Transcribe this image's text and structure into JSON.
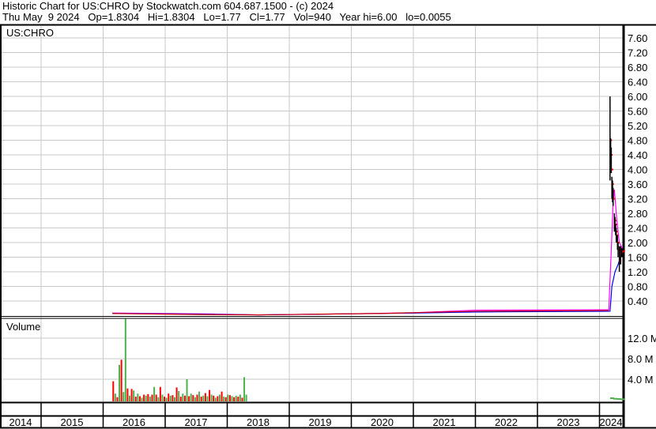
{
  "header": {
    "title": "Historic Chart for US:CHRO by Stockwatch.com 604.687.1500 - (c) 2024",
    "quote": "Thu May  9 2024   Op=1.8304   Hi=1.8304   Lo=1.77   Cl=1.77   Vol=940   Year hi=6.00   lo=0.0055"
  },
  "chart_data": [
    {
      "type": "line",
      "title": "US:CHRO",
      "ylim": [
        0,
        8
      ],
      "y_ticks": [
        "0.40",
        "0.80",
        "1.20",
        "1.60",
        "2.00",
        "2.40",
        "2.80",
        "3.20",
        "3.60",
        "4.00",
        "4.40",
        "4.80",
        "5.20",
        "5.60",
        "6.00",
        "6.40",
        "6.80",
        "7.20",
        "7.60"
      ],
      "x_ticks": [
        "2014",
        "2015",
        "2016",
        "2017",
        "2018",
        "2019",
        "2020",
        "2021",
        "2022",
        "2023",
        "2024"
      ],
      "colors": {
        "price": "#000000",
        "up": "#ff0000",
        "ma_short": "#ff00ff",
        "ma_long": "#0000ff"
      },
      "ohlc_2024": [
        [
          2024.17,
          6.0,
          3.7,
          4.8
        ],
        [
          2024.18,
          4.85,
          4.2,
          4.4
        ],
        [
          2024.19,
          4.6,
          3.9,
          4.0
        ],
        [
          2024.2,
          3.8,
          3.2,
          3.6
        ],
        [
          2024.21,
          3.7,
          3.1,
          3.4
        ],
        [
          2024.22,
          3.5,
          3.0,
          3.2
        ],
        [
          2024.24,
          2.8,
          2.3,
          2.6
        ],
        [
          2024.25,
          2.7,
          2.3,
          2.5
        ],
        [
          2024.26,
          2.5,
          2.2,
          2.3
        ],
        [
          2024.27,
          2.4,
          2.0,
          2.2
        ],
        [
          2024.29,
          2.2,
          1.8,
          2.0
        ],
        [
          2024.3,
          2.0,
          1.6,
          1.8
        ],
        [
          2024.32,
          1.9,
          1.2,
          1.5
        ],
        [
          2024.34,
          1.9,
          1.4,
          1.7
        ],
        [
          2024.36,
          1.85,
          1.6,
          1.75
        ],
        [
          2024.38,
          1.83,
          1.77,
          1.77
        ]
      ],
      "close_early": [
        [
          2016.15,
          0.06
        ],
        [
          2016.5,
          0.05
        ],
        [
          2017.0,
          0.04
        ],
        [
          2017.6,
          0.03
        ],
        [
          2018.5,
          0.02
        ],
        [
          2019.5,
          0.04
        ],
        [
          2020.5,
          0.06
        ],
        [
          2021.0,
          0.08
        ],
        [
          2022.0,
          0.12
        ],
        [
          2023.0,
          0.13
        ],
        [
          2024.15,
          0.14
        ]
      ],
      "ma_short": [
        [
          2016.15,
          0.07
        ],
        [
          2017.6,
          0.05
        ],
        [
          2018.5,
          0.02
        ],
        [
          2020.0,
          0.05
        ],
        [
          2021.0,
          0.08
        ],
        [
          2022.0,
          0.15
        ],
        [
          2024.15,
          0.16
        ],
        [
          2024.19,
          1.8
        ],
        [
          2024.22,
          3.1
        ],
        [
          2024.24,
          3.45
        ],
        [
          2024.28,
          2.6
        ],
        [
          2024.32,
          2.0
        ],
        [
          2024.38,
          1.8
        ]
      ],
      "ma_long": [
        [
          2016.15,
          0.06
        ],
        [
          2017.6,
          0.04
        ],
        [
          2018.5,
          0.02
        ],
        [
          2020.0,
          0.05
        ],
        [
          2021.0,
          0.07
        ],
        [
          2022.0,
          0.1
        ],
        [
          2024.17,
          0.12
        ],
        [
          2024.2,
          0.8
        ],
        [
          2024.25,
          1.2
        ],
        [
          2024.3,
          1.4
        ],
        [
          2024.34,
          1.6
        ],
        [
          2024.38,
          1.77
        ]
      ]
    },
    {
      "type": "bar",
      "title": "Volume",
      "ylim": [
        0,
        16
      ],
      "y_ticks": [
        "4.0 M",
        "8.0 M",
        "12.0 M"
      ],
      "volume_start": 2016.15,
      "volume_step": 0.033,
      "volume": [
        3.6,
        1.2,
        0.5,
        6.8,
        7.8,
        1.5,
        15.8,
        2.2,
        0.8,
        2.1,
        1.8,
        0.6,
        1.2,
        0.7,
        0.4,
        1.0,
        0.8,
        1.1,
        0.6,
        1.0,
        2.5,
        1.0,
        0.5,
        2.5,
        1.0,
        0.6,
        0.4,
        1.2,
        0.8,
        0.9,
        0.5,
        2.4,
        1.7,
        0.6,
        1.2,
        0.8,
        4.0,
        0.7,
        1.2,
        0.9,
        0.5,
        1.0,
        1.6,
        0.6,
        0.8,
        1.3,
        0.7,
        1.9,
        1.0,
        0.8,
        0.4,
        0.7,
        1.0,
        1.6,
        0.6,
        0.5,
        1.0,
        0.9,
        0.7,
        0.5,
        0.8,
        0.6,
        1.0,
        0.4,
        4.4,
        1.0
      ],
      "volume_colors": "rgrgrggrgrgrgrgrgrgrgrgrgrgrgrgrgrgrgrgrgrgrgrgrgrgrgrgrgrgrgrgrg",
      "volume_2024": [
        [
          2024.17,
          0.3
        ],
        [
          2024.22,
          0.2
        ],
        [
          2024.28,
          0.15
        ],
        [
          2024.34,
          0.1
        ]
      ]
    }
  ]
}
